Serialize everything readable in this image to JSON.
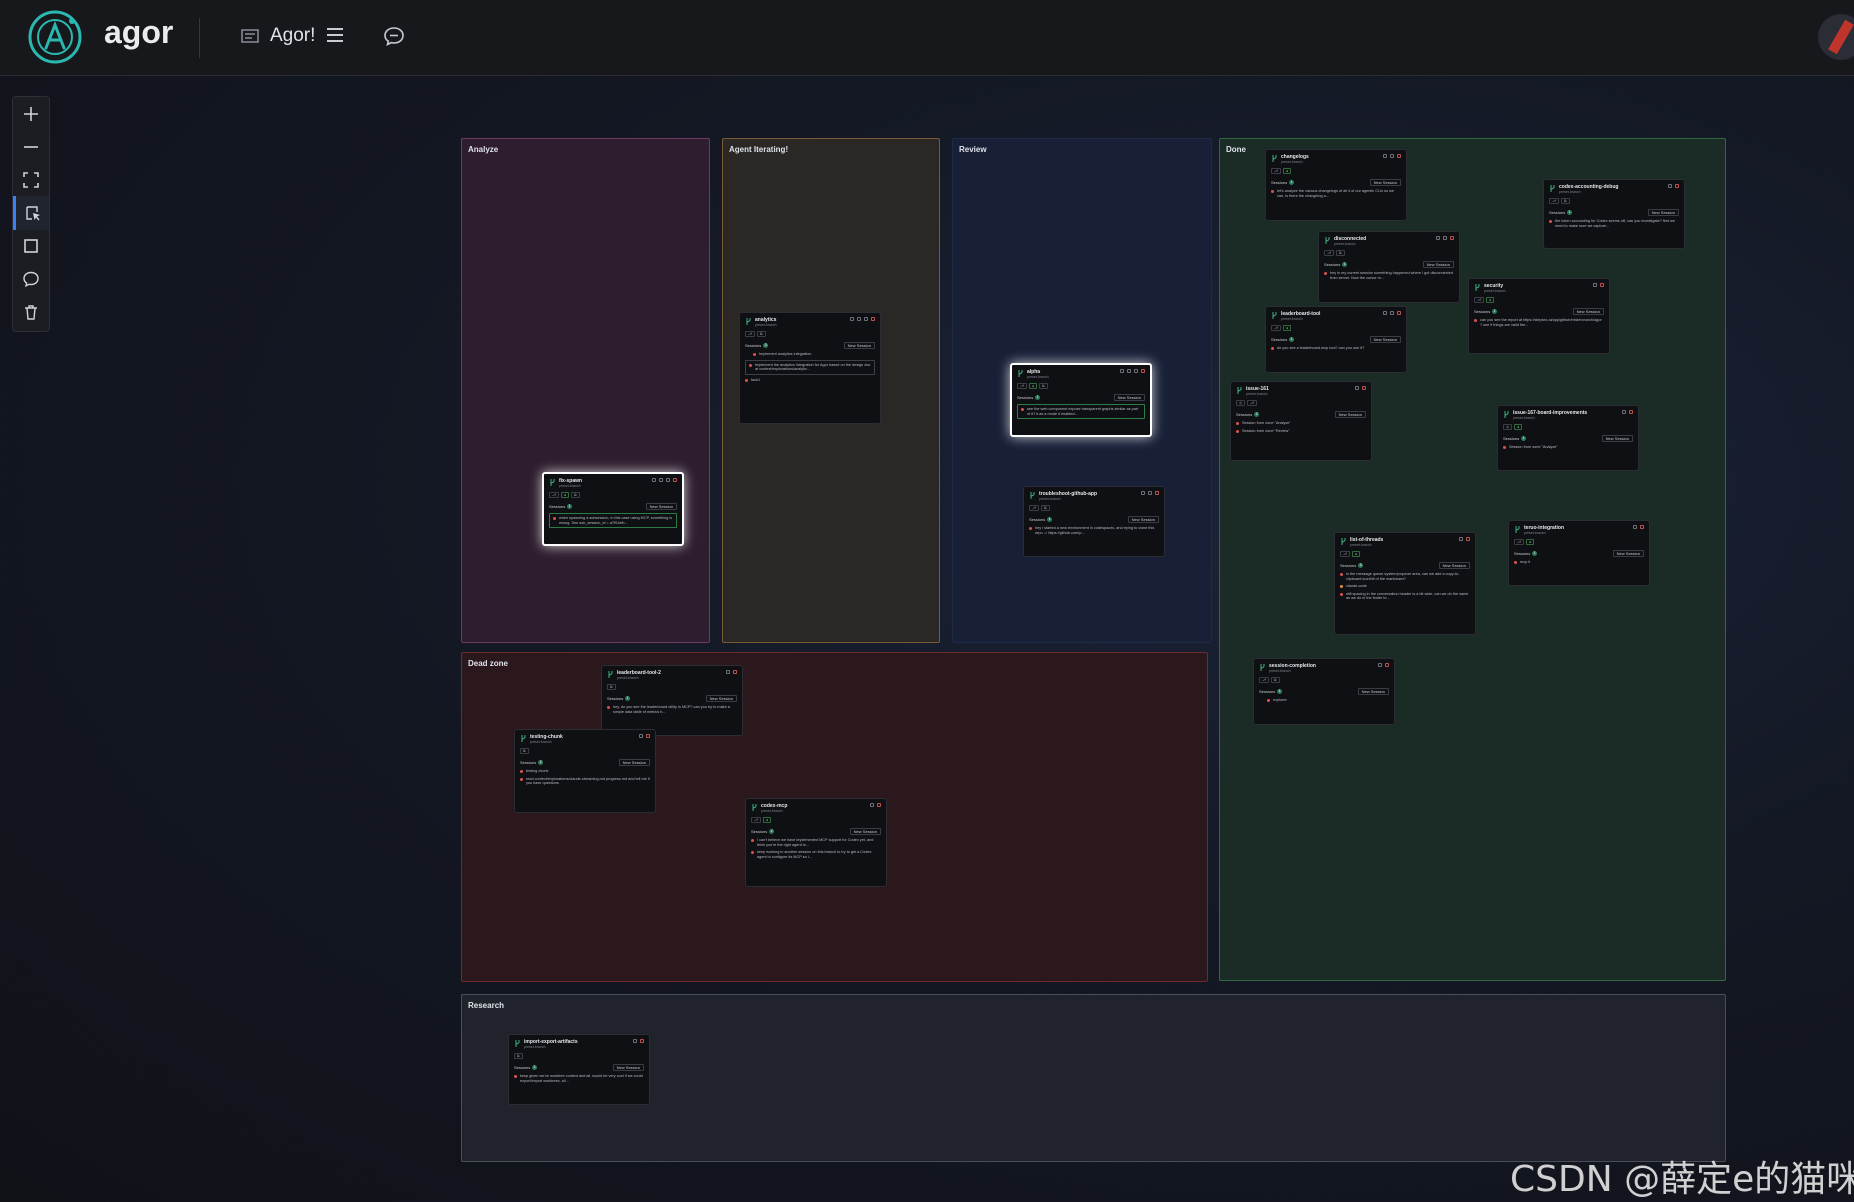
{
  "header": {
    "brand": "agor",
    "board_name": "Agor!"
  },
  "toolbar": {
    "tools": [
      "zoom-in",
      "zoom-out",
      "fit-view",
      "select",
      "rectangle",
      "comment",
      "delete"
    ]
  },
  "zones": {
    "analyze": "Analyze",
    "agent": "Agent Iterating!",
    "review": "Review",
    "done": "Done",
    "dead": "Dead zone",
    "research": "Research"
  },
  "card_common": {
    "subtitle": "preset-branch",
    "sessions": "Sessions",
    "new_session": "New Session"
  },
  "cards": {
    "fix_spawn": {
      "title": "fix-spawn",
      "sessions_count": "1",
      "s1": "when spawning a subsession, in this case using MCP, something is wrong. See sub_session_id = a7f91efb..."
    },
    "analytics": {
      "title": "analytics",
      "sessions_count": "3",
      "s1": "Implement analytics integration",
      "s2": "Implement the analytics integration for Agor based on the design doc at context/explorations/analytic...",
      "s3": "task1"
    },
    "alpha": {
      "title": "alpha",
      "sessions_count": "1",
      "s1": "see the web component expose transparent graphs similar as part of it? it as a mode it enabled..."
    },
    "troubleshoot": {
      "title": "troubleshoot-github-app",
      "sessions_count": "1",
      "s1": "hey i started a new environment in codespaces, and trying to clone this repo -> https://github.com/p..."
    },
    "changelogs": {
      "title": "changelogs",
      "sessions_count": "1",
      "s1": "let's analyze the various changelogs of all 4 of our agentic CLIs so we can, is there the changelog a..."
    },
    "disconnected": {
      "title": "disconnected",
      "sessions_count": "1",
      "s1": "hey in my current session something happened where I got disconnected from server. Now the cursor m..."
    },
    "leaderboard_tool": {
      "title": "leaderboard-tool",
      "sessions_count": "1",
      "s1": "do you see a leaderboard.mcp tool? can you use it?"
    },
    "codex_debug": {
      "title": "codex-accounting-debug",
      "sessions_count": "1",
      "s1": "the token accounting for Codex seems off, can you investigate? first we need to make sure we capture..."
    },
    "security": {
      "title": "security",
      "sessions_count": "1",
      "s1": "can you see the report at https://stepsec.ai/app/github/mistercrunch/agor ? see if things are valid the..."
    },
    "issue_161": {
      "title": "issue-161",
      "sessions_count": "2",
      "s1": "Session from zone \"Analyze\"",
      "s2": "Session from zone \"Review\""
    },
    "issue_167": {
      "title": "issue-167-board-improvements",
      "sessions_count": "1",
      "s1": "Session from zone \"Analyze\""
    },
    "list_threads": {
      "title": "list-of-threads",
      "sessions_count": "3",
      "s1": "in the message queue system/popover area, can we add a copy-to-clipboard icon/bit of the markdown?",
      "s2": "claude-code",
      "s3": "still spacing in the conversation header is a bit wide, can we do the same as we do in the footer to..."
    },
    "teruo": {
      "title": "teruo-integration",
      "sessions_count": "1",
      "s1": "mcp.it"
    },
    "session_compl": {
      "title": "session-completion",
      "sessions_count": "1",
      "s1": "explorer"
    },
    "leaderboard_tool_2": {
      "title": "leaderboard-tool-2",
      "sessions_count": "1",
      "s1": "hey, do you see the leaderboard utility in MCP? can you try to make a simple data table of metrics b..."
    },
    "testing_chunk": {
      "title": "testing-chunk",
      "sessions_count": "2",
      "s1": "testing chunk",
      "s2": "read context/explorations/claude-streaming.md progress.md and tell me if you have questions"
    },
    "codex_mcp": {
      "title": "codex-mcp",
      "sessions_count": "2",
      "s1": "I can't believe we have implemented MCP support for Codex yet, and think you're the right agent to...",
      "s2": "keep working in another session on this branch to try to get a Codex agent to configure its MCP so i..."
    },
    "import_export": {
      "title": "import-export-artifacts",
      "sessions_count": "1",
      "s1": "keep given we've worktree context and all, would be very cool if we could export/import worktrees, all..."
    }
  },
  "watermark": "CSDN @薛定e的猫咪",
  "colors": {
    "accent": "#3b82f6",
    "analyze": "#3a2236",
    "agent": "#2c2926",
    "review": "#1a2240",
    "done": "#1e2f2a",
    "dead": "#2e1a1e",
    "research": "#22252c"
  }
}
